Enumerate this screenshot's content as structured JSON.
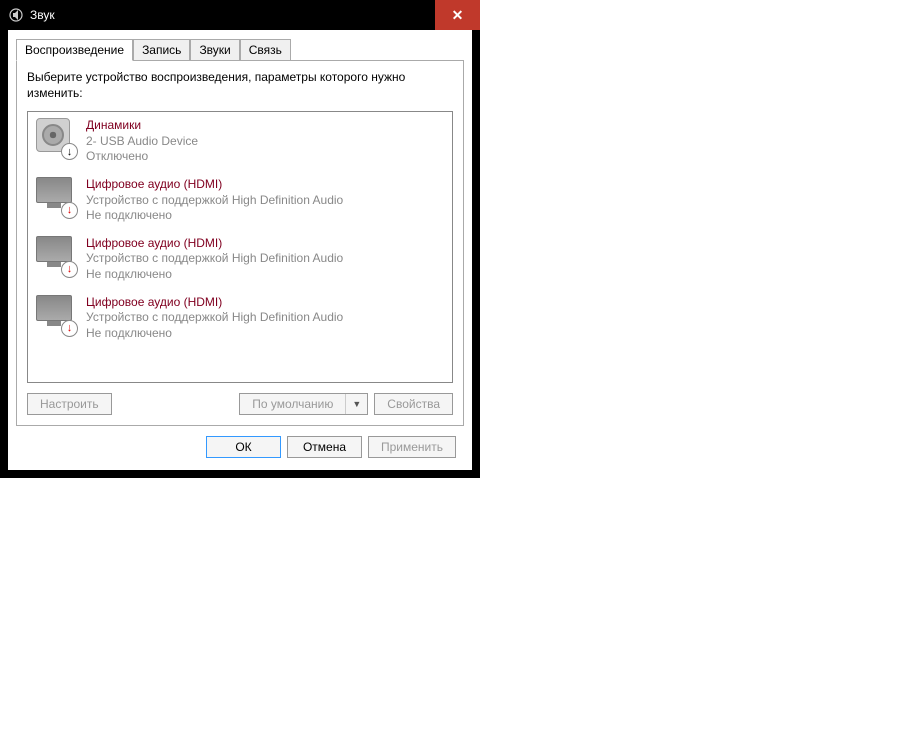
{
  "window": {
    "title": "Звук"
  },
  "tabs": [
    {
      "label": "Воспроизведение",
      "active": true
    },
    {
      "label": "Запись",
      "active": false
    },
    {
      "label": "Звуки",
      "active": false
    },
    {
      "label": "Связь",
      "active": false
    }
  ],
  "instruction": "Выберите устройство воспроизведения, параметры которого нужно изменить:",
  "devices": [
    {
      "name": "Динамики",
      "sub": "2- USB Audio Device",
      "status": "Отключено",
      "icon": "speaker",
      "badge": "down"
    },
    {
      "name": "Цифровое аудио (HDMI)",
      "sub": "Устройство с поддержкой High Definition Audio",
      "status": "Не подключено",
      "icon": "monitor",
      "badge": "red"
    },
    {
      "name": "Цифровое аудио (HDMI)",
      "sub": "Устройство с поддержкой High Definition Audio",
      "status": "Не подключено",
      "icon": "monitor",
      "badge": "red"
    },
    {
      "name": "Цифровое аудио (HDMI)",
      "sub": "Устройство с поддержкой High Definition Audio",
      "status": "Не подключено",
      "icon": "monitor",
      "badge": "red"
    }
  ],
  "buttons": {
    "configure": "Настроить",
    "default": "По умолчанию",
    "properties": "Свойства",
    "ok": "ОК",
    "cancel": "Отмена",
    "apply": "Применить"
  }
}
